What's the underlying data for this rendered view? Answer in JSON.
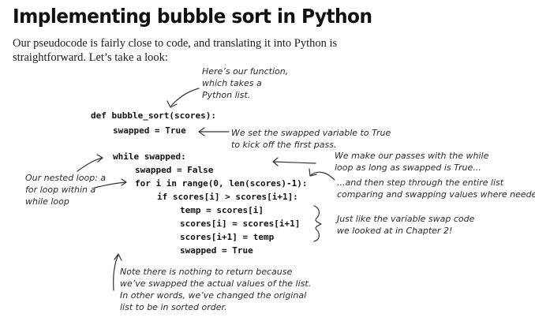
{
  "heading": "Implementing bubble sort in Python",
  "intro": {
    "line1": "Our pseudocode is fairly close to code, and translating it into Python is",
    "line2": "straightforward. Let’s take a look:"
  },
  "code": [
    "def bubble_sort(scores):",
    "swapped = True",
    "while swapped:",
    "swapped = False",
    "for i in range(0, len(scores)-1):",
    "if scores[i] > scores[i+1]:",
    "temp = scores[i]",
    "scores[i] = scores[i+1]",
    "scores[i+1] = temp",
    "swapped = True"
  ],
  "annotations": {
    "function_note": [
      "Here’s our function,",
      "which takes a",
      "Python list."
    ],
    "swapped_note": [
      "We set the swapped variable to True",
      "to kick off the first pass."
    ],
    "while_note": [
      "We make our passes with the while",
      "loop as long as swapped is True..."
    ],
    "for_note": [
      "...and then step through the entire list",
      "comparing and swapping values where needed."
    ],
    "swap_note": [
      "Just like the variable swap code",
      "we looked at in Chapter 2!"
    ],
    "nested_note": [
      "Our nested loop: a",
      "for loop within a",
      "while loop"
    ],
    "return_note": [
      "Note there is nothing to return because",
      "we’ve swapped the actual values of the list.",
      "In other words, we’ve changed the original",
      "list to be in sorted order."
    ]
  }
}
